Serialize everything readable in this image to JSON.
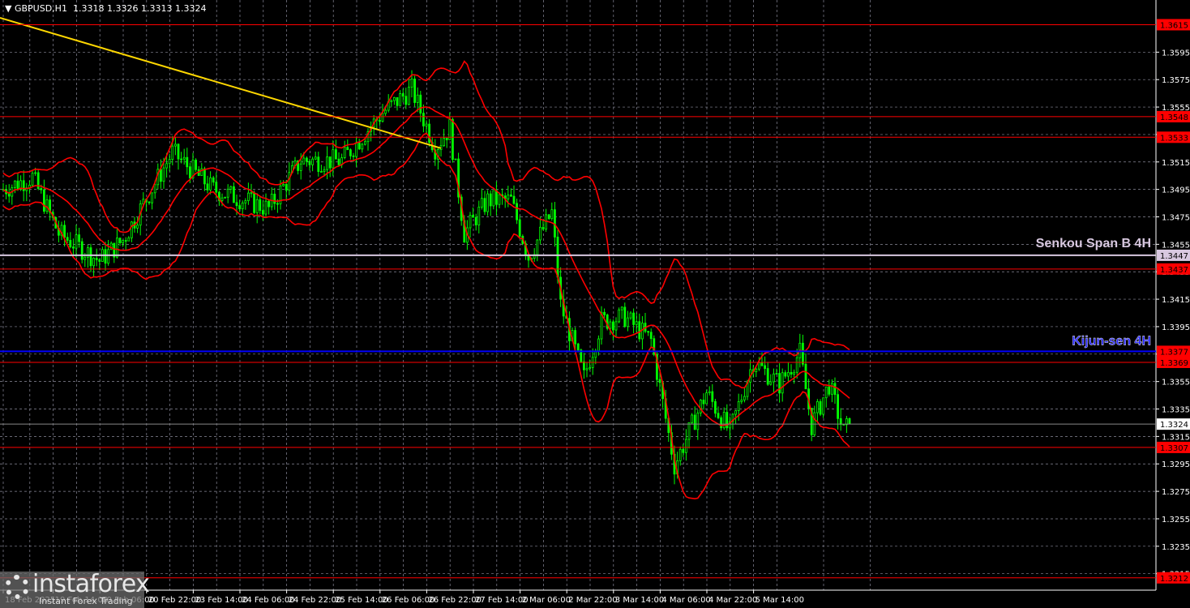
{
  "header": {
    "symbol": "GBPUSD,H1",
    "open": "1.3318",
    "high": "1.3326",
    "low": "1.3313",
    "close": "1.3324"
  },
  "logo": {
    "name": "instaforex",
    "tagline": "Instant Forex Trading"
  },
  "colors": {
    "background": "#000000",
    "candles": "#00ff00",
    "bands": "#ff0000",
    "trendline": "#ffd700",
    "kijun": "#0000ff",
    "senkou": "#d8c8e0",
    "level": "#ff0000",
    "grid": "#8a8a9a"
  },
  "chart_data": {
    "type": "candlestick",
    "title": "GBPUSD,H1",
    "ylim": [
      1.3203,
      1.3633
    ],
    "y_ticks": [
      "1.3595",
      "1.3575",
      "1.3555",
      "1.3535",
      "1.3515",
      "1.3495",
      "1.3475",
      "1.3455",
      "1.3435",
      "1.3415",
      "1.3395",
      "1.3375",
      "1.3355",
      "1.3335",
      "1.3315",
      "1.3295",
      "1.3275",
      "1.3255",
      "1.3235",
      "1.3215"
    ],
    "x_ticks": [
      {
        "bar": 0,
        "label": "18 Feb 2025"
      },
      {
        "bar": 16,
        "label": "19 Feb 14:00"
      },
      {
        "bar": 32,
        "label": "20 Feb 06:00"
      },
      {
        "bar": 48,
        "label": "20 Feb 22:00"
      },
      {
        "bar": 64,
        "label": "23 Feb 14:00"
      },
      {
        "bar": 80,
        "label": "24 Feb 06:00"
      },
      {
        "bar": 96,
        "label": "24 Feb 22:00"
      },
      {
        "bar": 112,
        "label": "25 Feb 14:00"
      },
      {
        "bar": 128,
        "label": "26 Feb 06:00"
      },
      {
        "bar": 144,
        "label": "26 Feb 22:00"
      },
      {
        "bar": 160,
        "label": "27 Feb 14:00"
      },
      {
        "bar": 176,
        "label": "2 Mar 06:00"
      },
      {
        "bar": 192,
        "label": "2 Mar 22:00"
      },
      {
        "bar": 208,
        "label": "3 Mar 14:00"
      },
      {
        "bar": 224,
        "label": "4 Mar 06:00"
      },
      {
        "bar": 240,
        "label": "4 Mar 22:00"
      },
      {
        "bar": 256,
        "label": "5 Mar 14:00"
      }
    ],
    "price_path": [
      [
        0,
        1.3495
      ],
      [
        10,
        1.3504
      ],
      [
        19,
        1.3463
      ],
      [
        33,
        1.3443
      ],
      [
        41,
        1.3458
      ],
      [
        58,
        1.3522
      ],
      [
        72,
        1.3495
      ],
      [
        91,
        1.3481
      ],
      [
        102,
        1.3516
      ],
      [
        116,
        1.3516
      ],
      [
        130,
        1.3551
      ],
      [
        140,
        1.3568
      ],
      [
        148,
        1.3525
      ],
      [
        153,
        1.354
      ],
      [
        158,
        1.3463
      ],
      [
        166,
        1.3487
      ],
      [
        174,
        1.3487
      ],
      [
        180,
        1.3446
      ],
      [
        188,
        1.3478
      ],
      [
        191,
        1.3411
      ],
      [
        199,
        1.3358
      ],
      [
        205,
        1.3399
      ],
      [
        213,
        1.3402
      ],
      [
        222,
        1.3385
      ],
      [
        230,
        1.3294
      ],
      [
        236,
        1.3323
      ],
      [
        241,
        1.3347
      ],
      [
        249,
        1.3318
      ],
      [
        257,
        1.337
      ],
      [
        266,
        1.3353
      ],
      [
        273,
        1.3376
      ],
      [
        277,
        1.3323
      ],
      [
        283,
        1.3353
      ],
      [
        288,
        1.3318
      ],
      [
        290,
        1.3324
      ]
    ],
    "levels": [
      {
        "price": 1.3615,
        "label": "1.3615",
        "kind": "resistance"
      },
      {
        "price": 1.3548,
        "label": "1.3548",
        "kind": "resistance"
      },
      {
        "price": 1.3533,
        "label": "1.3533",
        "kind": "resistance"
      },
      {
        "price": 1.3447,
        "label": "1.3447",
        "kind": "senkou",
        "name": "Senkou Span B 4H"
      },
      {
        "price": 1.3437,
        "label": "1.3437",
        "kind": "resistance"
      },
      {
        "price": 1.3377,
        "label": "1.3377",
        "kind": "kijun",
        "name": "Kijun-sen 4H"
      },
      {
        "price": 1.3369,
        "label": "1.3369",
        "kind": "resistance"
      },
      {
        "price": 1.3324,
        "label": "1.3324",
        "kind": "current"
      },
      {
        "price": 1.3307,
        "label": "1.3307",
        "kind": "support"
      },
      {
        "price": 1.3212,
        "label": "1.3212",
        "kind": "support"
      }
    ],
    "trendline": {
      "from": [
        0,
        1.362
      ],
      "to": [
        150,
        1.3525
      ]
    },
    "indicator": "Bollinger Bands (20, 2)"
  }
}
